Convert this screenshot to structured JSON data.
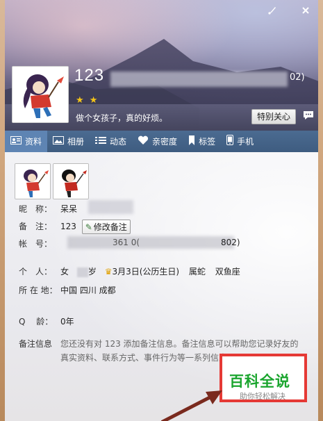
{
  "window": {
    "skin_icon": "brush-icon",
    "close_icon": "close-icon"
  },
  "profile": {
    "display_name": "123",
    "qq_tail": "02)",
    "signature": "做个女孩子，真的好烦。",
    "special_care_label": "特别关心",
    "stars": "★ ★"
  },
  "tabs": [
    {
      "label": "资料",
      "icon": "profile-card-icon",
      "active": true
    },
    {
      "label": "相册",
      "icon": "album-icon",
      "active": false
    },
    {
      "label": "动态",
      "icon": "feed-list-icon",
      "active": false
    },
    {
      "label": "亲密度",
      "icon": "heart-icon",
      "active": false
    },
    {
      "label": "标签",
      "icon": "bookmark-icon",
      "active": false
    },
    {
      "label": "手机",
      "icon": "phone-icon",
      "active": false
    }
  ],
  "info": {
    "nickname_label": "昵　称：",
    "nickname_value": "呆呆",
    "remark_label": "备　注：",
    "remark_value": "123",
    "edit_remark_label": "修改备注",
    "account_label": "帐　号：",
    "account_value_mid": "361 0(",
    "account_value_tail": "802)",
    "personal_label": "个　人：",
    "gender": "女",
    "age_suffix": "岁",
    "birthday": "3月3日(公历生日)",
    "zodiac": "属蛇",
    "star_sign": "双鱼座",
    "location_label": "所 在 地：",
    "location_value": "中国 四川 成都",
    "qage_label": "Q　 龄：",
    "qage_value": "0年",
    "remark_info_label": "备注信息",
    "remark_info_text_1": "您还没有对 123 添加备注信息。备注信息可以帮助您记录好友的",
    "remark_info_text_2": "真实资料、联系方式、事件行为等一系列信息"
  },
  "watermark": {
    "title": "百科全说",
    "subtitle": "助你轻松解决"
  },
  "colors": {
    "tabbar": "#4b6b91",
    "tab_active": "#5e84b3",
    "watermark_border": "#e53935",
    "watermark_title": "#1aa52e",
    "arrow": "#7a2a1e"
  }
}
